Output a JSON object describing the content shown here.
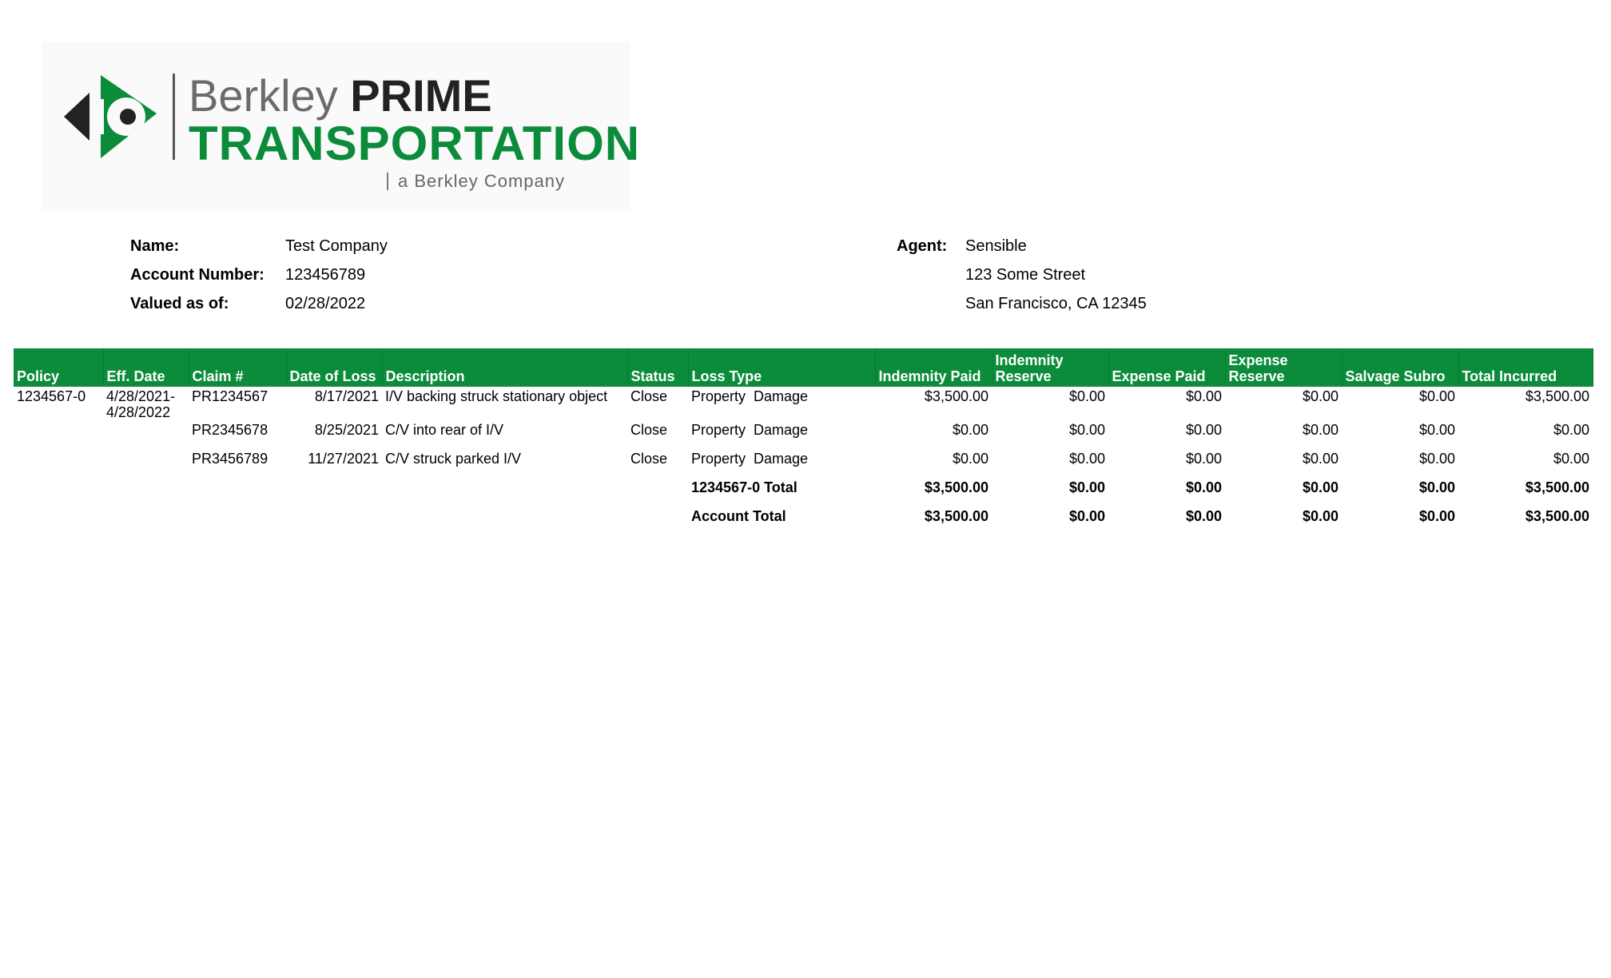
{
  "logo": {
    "line1_light": "Berkley",
    "line1_bold": "PRIME",
    "line2": "TRANSPORTATION",
    "tagline": "a Berkley Company",
    "brand_green": "#0b8c3a",
    "brand_dark": "#222222"
  },
  "info": {
    "name_label": "Name:",
    "name_value": "Test Company",
    "account_label": "Account Number:",
    "account_value": "123456789",
    "valued_label": "Valued as of:",
    "valued_value": "02/28/2022",
    "agent_label": "Agent:",
    "agent_name": "Sensible",
    "agent_street": "123 Some Street",
    "agent_city": "San Francisco, CA 12345"
  },
  "table": {
    "header_color": "#0b8c3a",
    "headers": [
      "Policy",
      "Eff. Date",
      "Claim #",
      "Date of Loss",
      "Description",
      "Status",
      "Loss Type",
      "Indemnity Paid",
      "Indemnity Reserve",
      "Expense Paid",
      "Expense Reserve",
      "Salvage Subro",
      "Total Incurred"
    ],
    "rows": [
      {
        "policy": "1234567-0",
        "eff_date": "4/28/2021-4/28/2022",
        "claim": "PR1234567",
        "date_of_loss": "8/17/2021",
        "description": "I/V backing struck stationary object",
        "status": "Close",
        "loss_type": "Property  Damage",
        "indemnity_paid": "$3,500.00",
        "indemnity_reserve": "$0.00",
        "expense_paid": "$0.00",
        "expense_reserve": "$0.00",
        "salvage_subro": "$0.00",
        "total_incurred": "$3,500.00"
      },
      {
        "policy": "",
        "eff_date": "",
        "claim": "PR2345678",
        "date_of_loss": "8/25/2021",
        "description": "C/V into rear of I/V",
        "status": "Close",
        "loss_type": "Property  Damage",
        "indemnity_paid": "$0.00",
        "indemnity_reserve": "$0.00",
        "expense_paid": "$0.00",
        "expense_reserve": "$0.00",
        "salvage_subro": "$0.00",
        "total_incurred": "$0.00"
      },
      {
        "policy": "",
        "eff_date": "",
        "claim": "PR3456789",
        "date_of_loss": "11/27/2021",
        "description": "C/V struck parked I/V",
        "status": "Close",
        "loss_type": "Property  Damage",
        "indemnity_paid": "$0.00",
        "indemnity_reserve": "$0.00",
        "expense_paid": "$0.00",
        "expense_reserve": "$0.00",
        "salvage_subro": "$0.00",
        "total_incurred": "$0.00"
      }
    ],
    "policy_total": {
      "label": "1234567-0 Total",
      "indemnity_paid": "$3,500.00",
      "indemnity_reserve": "$0.00",
      "expense_paid": "$0.00",
      "expense_reserve": "$0.00",
      "salvage_subro": "$0.00",
      "total_incurred": "$3,500.00"
    },
    "account_total": {
      "label": "Account Total",
      "indemnity_paid": "$3,500.00",
      "indemnity_reserve": "$0.00",
      "expense_paid": "$0.00",
      "expense_reserve": "$0.00",
      "salvage_subro": "$0.00",
      "total_incurred": "$3,500.00"
    }
  }
}
